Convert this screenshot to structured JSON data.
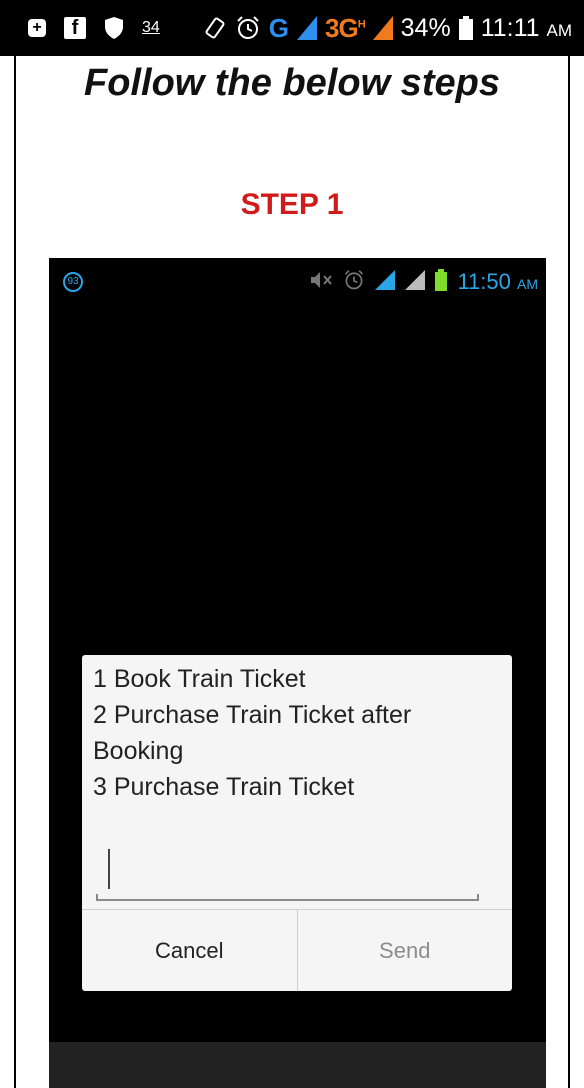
{
  "outer_status": {
    "badge": "34",
    "network_g": "G",
    "network_3g": "3G",
    "network_sup": "H",
    "battery": "34%",
    "time": "11:11",
    "ampm": "AM",
    "icons": [
      "plus-square-icon",
      "facebook-icon",
      "shield-icon",
      "badge-34-icon",
      "rotate-icon",
      "alarm-icon",
      "signal-icon",
      "battery-icon"
    ]
  },
  "page": {
    "title": "Follow the below steps",
    "step": "STEP 1",
    "step_color": "#d11a1a"
  },
  "inner_status": {
    "circle_badge": "93",
    "time": "11:50",
    "ampm": "AM",
    "accent": "#2aa6e6",
    "battery_color": "#7fdc2a"
  },
  "dialog": {
    "lines": [
      "1 Book Train Ticket",
      "2 Purchase Train Ticket after\nBooking",
      "3 Purchase Train Ticket"
    ],
    "input_value": "",
    "cancel": "Cancel",
    "send": "Send"
  }
}
